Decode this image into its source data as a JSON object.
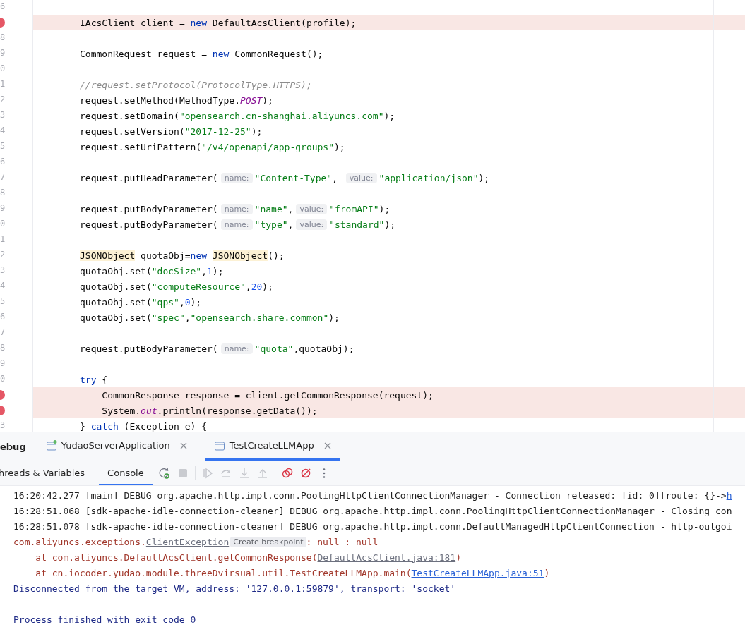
{
  "editor": {
    "lines": [
      {
        "number": "6",
        "breakpoint": false
      },
      {
        "breakpoint": true,
        "segments": [
          {
            "text": "IAcsClient client = ",
            "kind": "plain"
          },
          {
            "text": "new",
            "kind": "kw"
          },
          {
            "text": " DefaultAcsClient(profile);",
            "kind": "plain"
          }
        ]
      },
      {
        "number": "8",
        "breakpoint": false
      },
      {
        "number": "9",
        "breakpoint": false,
        "segments": [
          {
            "text": "CommonRequest request = ",
            "kind": "plain"
          },
          {
            "text": "new",
            "kind": "kw"
          },
          {
            "text": " CommonRequest();",
            "kind": "plain"
          }
        ]
      },
      {
        "number": "0",
        "breakpoint": false
      },
      {
        "number": "1",
        "breakpoint": false,
        "segments": [
          {
            "text": "//request.setProtocol(ProtocolType.HTTPS);",
            "kind": "comment"
          }
        ]
      },
      {
        "number": "2",
        "breakpoint": false,
        "segments": [
          {
            "text": "request.setMethod(MethodType.",
            "kind": "plain"
          },
          {
            "text": "POST",
            "kind": "static"
          },
          {
            "text": ");",
            "kind": "plain"
          }
        ]
      },
      {
        "number": "3",
        "breakpoint": false,
        "segments": [
          {
            "text": "request.setDomain(",
            "kind": "plain"
          },
          {
            "text": "\"opensearch.cn-shanghai.aliyuncs.com\"",
            "kind": "str"
          },
          {
            "text": ");",
            "kind": "plain"
          }
        ]
      },
      {
        "number": "4",
        "breakpoint": false,
        "segments": [
          {
            "text": "request.setVersion(",
            "kind": "plain"
          },
          {
            "text": "\"2017-12-25\"",
            "kind": "str"
          },
          {
            "text": ");",
            "kind": "plain"
          }
        ]
      },
      {
        "number": "5",
        "breakpoint": false,
        "segments": [
          {
            "text": "request.setUriPattern(",
            "kind": "plain"
          },
          {
            "text": "\"/v4/openapi/app-groups\"",
            "kind": "str"
          },
          {
            "text": ");",
            "kind": "plain"
          }
        ]
      },
      {
        "number": "6",
        "breakpoint": false
      },
      {
        "number": "7",
        "breakpoint": false,
        "segments": [
          {
            "text": "request.putHeadParameter(",
            "kind": "plain"
          },
          {
            "text": "name:",
            "kind": "hint"
          },
          {
            "text": "\"Content-Type\"",
            "kind": "str"
          },
          {
            "text": ", ",
            "kind": "plain"
          },
          {
            "text": "value:",
            "kind": "hint"
          },
          {
            "text": "\"application/json\"",
            "kind": "str"
          },
          {
            "text": ");",
            "kind": "plain"
          }
        ]
      },
      {
        "number": "8",
        "breakpoint": false
      },
      {
        "number": "9",
        "breakpoint": false,
        "segments": [
          {
            "text": "request.putBodyParameter(",
            "kind": "plain"
          },
          {
            "text": "name:",
            "kind": "hint"
          },
          {
            "text": "\"name\"",
            "kind": "str"
          },
          {
            "text": ",",
            "kind": "plain"
          },
          {
            "text": "value:",
            "kind": "hint"
          },
          {
            "text": "\"fromAPI\"",
            "kind": "str"
          },
          {
            "text": ");",
            "kind": "plain"
          }
        ]
      },
      {
        "number": "0",
        "breakpoint": false,
        "segments": [
          {
            "text": "request.putBodyParameter(",
            "kind": "plain"
          },
          {
            "text": "name:",
            "kind": "hint"
          },
          {
            "text": "\"type\"",
            "kind": "str"
          },
          {
            "text": ",",
            "kind": "plain"
          },
          {
            "text": "value:",
            "kind": "hint"
          },
          {
            "text": "\"standard\"",
            "kind": "str"
          },
          {
            "text": ");",
            "kind": "plain"
          }
        ]
      },
      {
        "number": "1",
        "breakpoint": false
      },
      {
        "number": "2",
        "breakpoint": false,
        "segments": [
          {
            "text": "JSONObject",
            "kind": "type-hl",
            "space_before": false
          },
          {
            "text": " quotaObj=",
            "kind": "plain"
          },
          {
            "text": "new",
            "kind": "kw"
          },
          {
            "text": "JSONObject",
            "kind": "type-hl",
            "space_before": true
          },
          {
            "text": "();",
            "kind": "plain"
          }
        ]
      },
      {
        "number": "3",
        "breakpoint": false,
        "segments": [
          {
            "text": "quotaObj.set(",
            "kind": "plain"
          },
          {
            "text": "\"docSize\"",
            "kind": "str"
          },
          {
            "text": ",",
            "kind": "plain"
          },
          {
            "text": "1",
            "kind": "num"
          },
          {
            "text": ");",
            "kind": "plain"
          }
        ]
      },
      {
        "number": "4",
        "breakpoint": false,
        "segments": [
          {
            "text": "quotaObj.set(",
            "kind": "plain"
          },
          {
            "text": "\"computeResource\"",
            "kind": "str"
          },
          {
            "text": ",",
            "kind": "plain"
          },
          {
            "text": "20",
            "kind": "num"
          },
          {
            "text": ");",
            "kind": "plain"
          }
        ]
      },
      {
        "number": "5",
        "breakpoint": false,
        "segments": [
          {
            "text": "quotaObj.set(",
            "kind": "plain"
          },
          {
            "text": "\"qps\"",
            "kind": "str"
          },
          {
            "text": ",",
            "kind": "plain"
          },
          {
            "text": "0",
            "kind": "num"
          },
          {
            "text": ");",
            "kind": "plain"
          }
        ]
      },
      {
        "number": "6",
        "breakpoint": false,
        "segments": [
          {
            "text": "quotaObj.set(",
            "kind": "plain"
          },
          {
            "text": "\"spec\"",
            "kind": "str"
          },
          {
            "text": ",",
            "kind": "plain"
          },
          {
            "text": "\"opensearch.share.common\"",
            "kind": "str"
          },
          {
            "text": ");",
            "kind": "plain"
          }
        ]
      },
      {
        "number": "7",
        "breakpoint": false
      },
      {
        "number": "8",
        "breakpoint": false,
        "segments": [
          {
            "text": "request.putBodyParameter(",
            "kind": "plain"
          },
          {
            "text": "name:",
            "kind": "hint"
          },
          {
            "text": "\"quota\"",
            "kind": "str"
          },
          {
            "text": ",quotaObj);",
            "kind": "plain"
          }
        ]
      },
      {
        "number": "9",
        "breakpoint": false
      },
      {
        "number": "0",
        "breakpoint": false,
        "segments": [
          {
            "text": "try",
            "kind": "kw"
          },
          {
            "text": " {",
            "kind": "plain"
          }
        ]
      },
      {
        "breakpoint": true,
        "segments": [
          {
            "text": "    CommonResponse response = client.getCommonResponse(request);",
            "kind": "plain"
          }
        ]
      },
      {
        "breakpoint": true,
        "segments": [
          {
            "text": "    System.",
            "kind": "plain"
          },
          {
            "text": "out",
            "kind": "static"
          },
          {
            "text": ".println(response.getData());",
            "kind": "plain"
          }
        ]
      },
      {
        "number": "3",
        "breakpoint": false,
        "segments": [
          {
            "text": "} ",
            "kind": "plain"
          },
          {
            "text": "catch",
            "kind": "kw"
          },
          {
            "text": " (Exception e) {",
            "kind": "plain"
          }
        ]
      }
    ]
  },
  "panel": {
    "title": "ebug",
    "tabs": [
      {
        "label": "YudaoServerApplication",
        "selected": false,
        "running": true
      },
      {
        "label": "TestCreateLLMApp",
        "selected": true,
        "running": false
      }
    ],
    "subtabs": [
      {
        "label": "hreads & Variables",
        "selected": false
      },
      {
        "label": "Console",
        "selected": true
      }
    ],
    "toolbar": [
      {
        "kind": "rerun",
        "disabled": false
      },
      {
        "kind": "stop",
        "disabled": true
      },
      {
        "kind": "sep"
      },
      {
        "kind": "resume",
        "disabled": true
      },
      {
        "kind": "step-over",
        "disabled": true
      },
      {
        "kind": "step-into",
        "disabled": true
      },
      {
        "kind": "step-out",
        "disabled": true
      },
      {
        "kind": "sep"
      },
      {
        "kind": "breakpoints",
        "disabled": false
      },
      {
        "kind": "mute",
        "disabled": false
      },
      {
        "kind": "more",
        "disabled": false
      }
    ],
    "console": [
      {
        "kind": "line",
        "segments": [
          {
            "text": "16:20:42.277 [main] DEBUG org.apache.http.impl.conn.PoolingHttpClientConnectionManager - Connection released: [id: 0][route: {}->",
            "kind": "text"
          },
          {
            "text": "h",
            "kind": "link"
          }
        ]
      },
      {
        "kind": "line",
        "segments": [
          {
            "text": "16:28:51.068 [sdk-apache-idle-connection-cleaner] DEBUG org.apache.http.impl.conn.PoolingHttpClientConnectionManager - Closing con",
            "kind": "text"
          }
        ]
      },
      {
        "kind": "line",
        "segments": [
          {
            "text": "16:28:51.078 [sdk-apache-idle-connection-cleaner] DEBUG org.apache.http.impl.conn.DefaultManagedHttpClientConnection - http-outgoi",
            "kind": "text"
          }
        ]
      },
      {
        "kind": "line",
        "segments": [
          {
            "text": "com.aliyuncs.exceptions.",
            "kind": "err"
          },
          {
            "text": "ClientException",
            "kind": "src-link"
          },
          {
            "text": "Create breakpoint",
            "kind": "badge"
          },
          {
            "text": ": null : null",
            "kind": "err"
          }
        ]
      },
      {
        "kind": "line",
        "segments": [
          {
            "text": "    at com.aliyuncs.DefaultAcsClient.getCommonResponse(",
            "kind": "err"
          },
          {
            "text": "DefaultAcsClient.java:181",
            "kind": "src-link"
          },
          {
            "text": ")",
            "kind": "err"
          }
        ]
      },
      {
        "kind": "line",
        "segments": [
          {
            "text": "    at cn.iocoder.yudao.module.threeDvirsual.util.TestCreateLLMApp.main(",
            "kind": "err"
          },
          {
            "text": "TestCreateLLMApp.java:51",
            "kind": "link"
          },
          {
            "text": ")",
            "kind": "err"
          }
        ]
      },
      {
        "kind": "line",
        "segments": [
          {
            "text": "Disconnected from the target VM, address: '127.0.0.1:59879', transport: 'socket'",
            "kind": "sys"
          }
        ]
      },
      {
        "kind": "blank"
      },
      {
        "kind": "line",
        "segments": [
          {
            "text": "Process finished with exit code 0",
            "kind": "sys"
          }
        ]
      }
    ]
  }
}
